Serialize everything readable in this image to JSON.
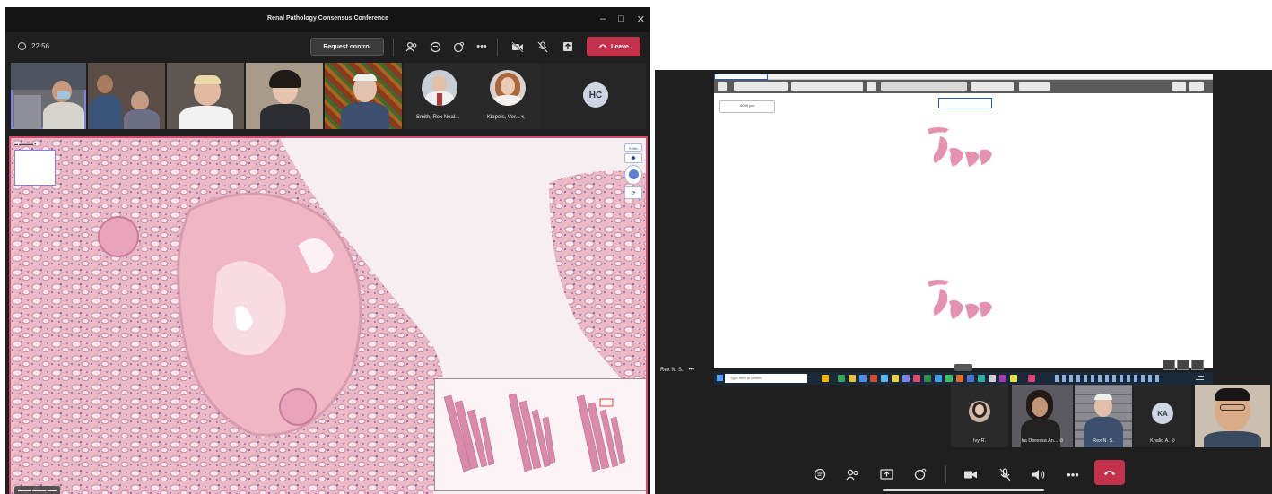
{
  "left_window": {
    "title": "Renal Pathology Consensus Conference",
    "window_controls": {
      "minimize": "–",
      "maximize": "□",
      "close": "✕"
    },
    "call_timer": "22:56",
    "request_control_label": "Request control",
    "leave_label": "Leave",
    "participants": [
      {
        "name": "Smith, Rex Neal...",
        "muted": false
      },
      {
        "name": "Klepeis, Ver...",
        "muted": true
      }
    ],
    "initials_tile": "HC",
    "viewer": {
      "zoom_level": "9.96x"
    }
  },
  "right_window": {
    "shared_screen_owner": "Rex N. S.",
    "more_label": "•••",
    "scale_bar": "5000 µm",
    "taskbar_search_placeholder": "Type here to search",
    "participants": [
      {
        "name": "Ivy R."
      },
      {
        "name": "Ira Doressa An...",
        "muted": true
      },
      {
        "name": "Rex N. S."
      },
      {
        "name": "Khalid A.",
        "muted": true
      }
    ],
    "ka_initials": "KA"
  }
}
